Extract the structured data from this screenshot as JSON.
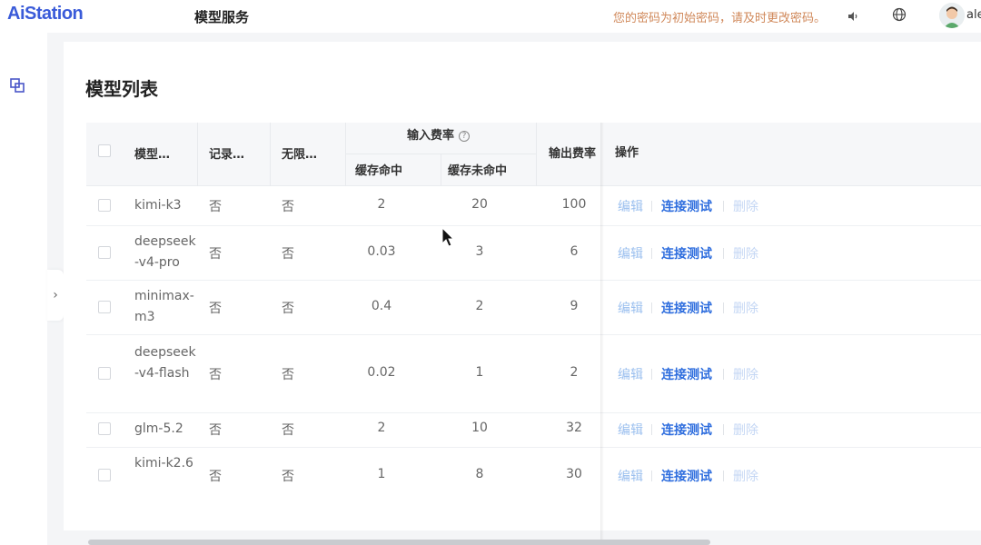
{
  "header": {
    "logo_text": "AiStation",
    "title": "模型服务",
    "password_notice": "您的密码为初始密码，请及时更改密码。",
    "username": "ale"
  },
  "colors": {
    "brand": "#3a5bd9",
    "notice": "#d0885a",
    "link_primary": "#2f6ede",
    "link_disabled": "#c3d6f4"
  },
  "icons": [
    "speaker-icon",
    "globe-icon",
    "avatar",
    "layers-icon",
    "chevron-right-icon",
    "help-circle-icon"
  ],
  "main": {
    "section_title": "模型列表",
    "columns": {
      "model": "模型…",
      "record": "记录…",
      "unlimited": "无限…",
      "input_rate": "输入费率",
      "cache_hit": "缓存命中",
      "cache_miss": "缓存未命中",
      "output_rate": "输出费率",
      "actions": "操作"
    },
    "actions": {
      "edit": "编辑",
      "test": "连接测试",
      "delete": "删除"
    },
    "rows": [
      {
        "model": "kimi-k3",
        "record": "否",
        "unlimited": "否",
        "cache_hit": "2",
        "cache_miss": "20",
        "output": "100"
      },
      {
        "model": "deepseek-v4-pro",
        "record": "否",
        "unlimited": "否",
        "cache_hit": "0.03",
        "cache_miss": "3",
        "output": "6"
      },
      {
        "model": "minimax-m3",
        "record": "否",
        "unlimited": "否",
        "cache_hit": "0.4",
        "cache_miss": "2",
        "output": "9"
      },
      {
        "model": "deepseek-v4-flash",
        "record": "否",
        "unlimited": "否",
        "cache_hit": "0.02",
        "cache_miss": "1",
        "output": "2"
      },
      {
        "model": "glm-5.2",
        "record": "否",
        "unlimited": "否",
        "cache_hit": "2",
        "cache_miss": "10",
        "output": "32"
      },
      {
        "model": "kimi-k2.6",
        "record": "否",
        "unlimited": "否",
        "cache_hit": "1",
        "cache_miss": "8",
        "output": "30"
      }
    ]
  }
}
